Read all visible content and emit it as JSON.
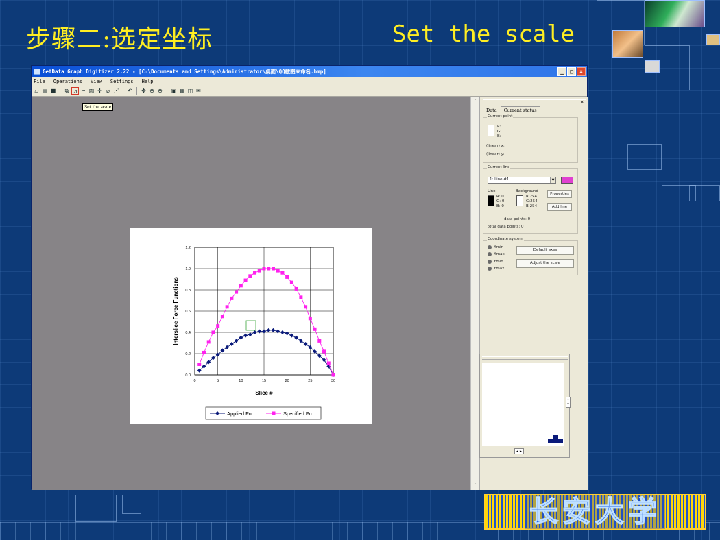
{
  "slide": {
    "title_cn": "步骤二:选定坐标",
    "title_en": "Set the scale",
    "logo_text": "长安大学"
  },
  "window": {
    "title": "GetData Graph Digitizer 2.22 - [C:\\Documents and Settings\\Administrator\\桌面\\QQ截图未命名.bmp]",
    "menu": [
      "File",
      "Operations",
      "View",
      "Settings",
      "Help"
    ],
    "tooltip": "Set the scale"
  },
  "panel": {
    "tabs": [
      "Data",
      "Current status"
    ],
    "current_point": {
      "label": "Current point",
      "r": "R:",
      "g": "G:",
      "b": "B:",
      "x_row": "(linear)  x:",
      "y_row": "(linear)  y:"
    },
    "current_line": {
      "label": "Current line",
      "selected": "1: Line #1",
      "line_label": "Line",
      "bg_label": "Background",
      "line_rgb": [
        "R: 0",
        "G: 0",
        "B: 0"
      ],
      "bg_rgb": [
        "R:254",
        "G:254",
        "B:254"
      ],
      "properties_btn": "Properties",
      "add_line_btn": "Add line",
      "data_points": "data points: 0",
      "total_points": "total data points: 0",
      "line_color": "#e040d0"
    },
    "coord_system": {
      "label": "Coordinate system",
      "radios": [
        "Xmin",
        "Xmax",
        "Ymin",
        "Ymax"
      ],
      "default_axes_btn": "Default axes",
      "adjust_scale_btn": "Adjust the scale"
    }
  },
  "chart_data": {
    "type": "line",
    "ylabel": "Interslice Force Functions",
    "xlabel": "Slice #",
    "xlim": [
      0,
      30
    ],
    "ylim": [
      0,
      1.2
    ],
    "xticks": [
      "0",
      "5",
      "10",
      "15",
      "20",
      "25",
      "30"
    ],
    "yticks": [
      "0.0",
      "0.2",
      "0.4",
      "0.6",
      "0.8",
      "1.0",
      "1.2"
    ],
    "grid": true,
    "legend": "bottom",
    "x": [
      1,
      2,
      3,
      4,
      5,
      6,
      7,
      8,
      9,
      10,
      11,
      12,
      13,
      14,
      15,
      16,
      17,
      18,
      19,
      20,
      21,
      22,
      23,
      24,
      25,
      26,
      27,
      28,
      29,
      30
    ],
    "series": [
      {
        "name": "Applied Fn.",
        "color": "#0a1a7a",
        "values": [
          0.04,
          0.08,
          0.12,
          0.16,
          0.19,
          0.23,
          0.26,
          0.29,
          0.32,
          0.35,
          0.37,
          0.38,
          0.4,
          0.41,
          0.41,
          0.42,
          0.42,
          0.41,
          0.4,
          0.39,
          0.37,
          0.35,
          0.32,
          0.29,
          0.26,
          0.22,
          0.18,
          0.14,
          0.08,
          0.0
        ]
      },
      {
        "name": "Specified Fn.",
        "color": "#ff22ee",
        "values": [
          0.1,
          0.21,
          0.31,
          0.4,
          0.46,
          0.55,
          0.64,
          0.72,
          0.78,
          0.84,
          0.89,
          0.93,
          0.96,
          0.98,
          1.0,
          1.0,
          1.0,
          0.98,
          0.96,
          0.92,
          0.87,
          0.81,
          0.73,
          0.64,
          0.53,
          0.43,
          0.32,
          0.22,
          0.11,
          0.0
        ]
      }
    ]
  }
}
